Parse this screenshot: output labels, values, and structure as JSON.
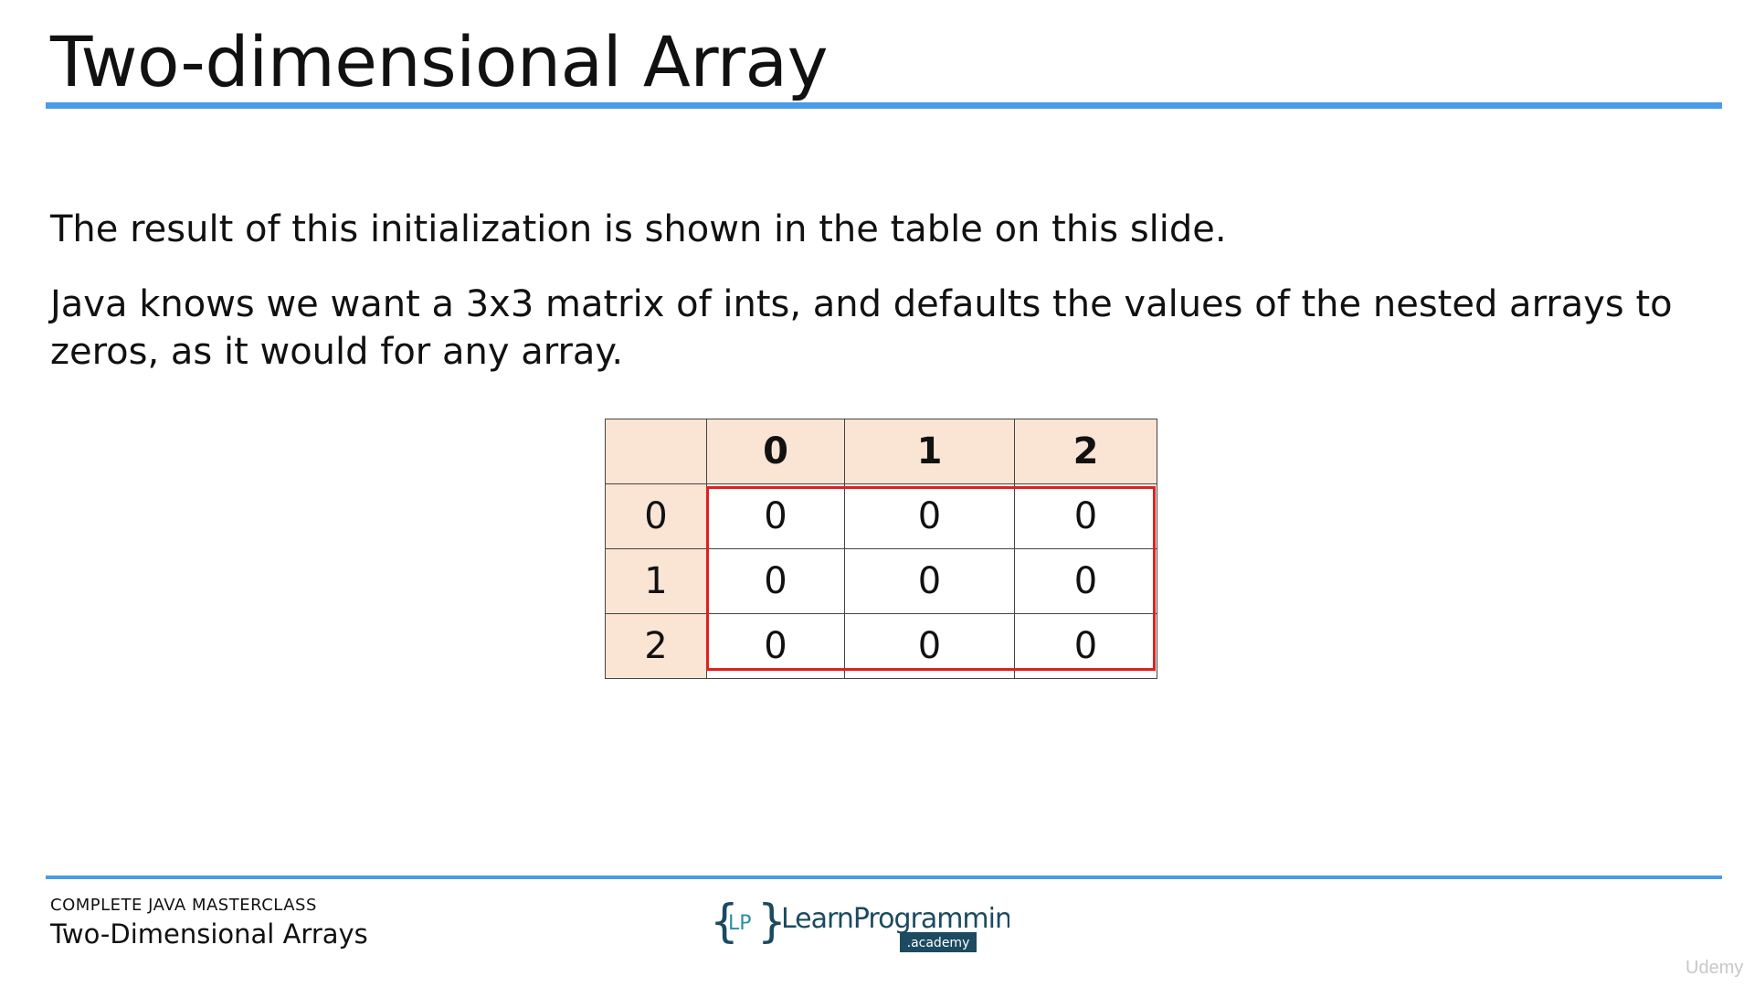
{
  "slide": {
    "title": "Two-dimensional Array",
    "paragraphs": [
      "The result of this initialization is shown in the table on this slide.",
      "Java knows we want a 3x3 matrix of ints, and defaults the values of the nested arrays to zeros, as it would for any array."
    ]
  },
  "matrix": {
    "column_headers": [
      "0",
      "1",
      "2"
    ],
    "rows": [
      {
        "label": "0",
        "values": [
          "0",
          "0",
          "0"
        ]
      },
      {
        "label": "1",
        "values": [
          "0",
          "0",
          "0"
        ]
      },
      {
        "label": "2",
        "values": [
          "0",
          "0",
          "0"
        ]
      }
    ]
  },
  "footer": {
    "course": "COMPLETE JAVA MASTERCLASS",
    "lecture": "Two-Dimensional Arrays"
  },
  "logo": {
    "bracket_text": "LP",
    "brand_name": "LearnProgramming",
    "sub_brand": ".academy"
  },
  "watermark": "Udemy",
  "colors": {
    "accent_blue": "#4a9be8",
    "header_fill": "#fae5d4",
    "highlight_red": "#e02020",
    "logo_teal": "#2a8fa0",
    "logo_dark": "#1c4a60"
  }
}
